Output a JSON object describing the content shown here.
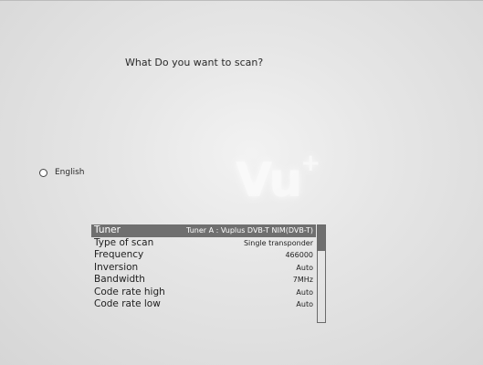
{
  "header": {
    "title": "What Do you want to scan?"
  },
  "watermark": {
    "brand": "Vu",
    "brand_sup": "+"
  },
  "language": {
    "label": "English",
    "selected": false
  },
  "settings": {
    "rows": [
      {
        "label": "Tuner",
        "value": "Tuner A : Vuplus DVB-T NIM(DVB-T)",
        "selected": true
      },
      {
        "label": "Type of scan",
        "value": "Single transponder",
        "selected": false
      },
      {
        "label": "Frequency",
        "value": "466000",
        "selected": false
      },
      {
        "label": "Inversion",
        "value": "Auto",
        "selected": false
      },
      {
        "label": "Bandwidth",
        "value": "7MHz",
        "selected": false
      },
      {
        "label": "Code rate high",
        "value": "Auto",
        "selected": false
      },
      {
        "label": "Code rate low",
        "value": "Auto",
        "selected": false
      }
    ],
    "scroll_fraction": 0.26
  },
  "colors": {
    "selection": "#6f6f6f",
    "background": "#e6e6e6",
    "text": "#1e1e1e"
  }
}
